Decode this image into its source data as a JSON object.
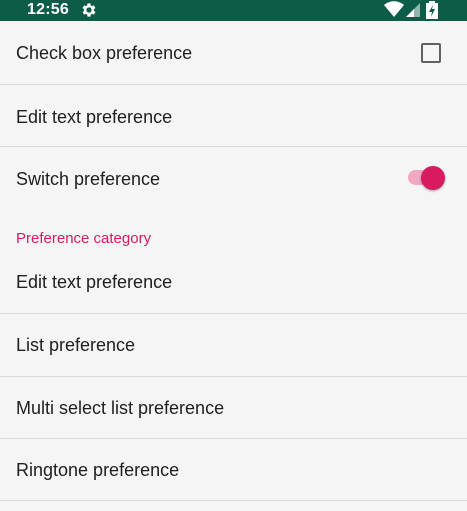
{
  "status_bar": {
    "time": "12:56",
    "icons": [
      "gear-icon",
      "wifi-icon",
      "signal-icon",
      "battery-icon"
    ]
  },
  "preferences": {
    "check_box": {
      "title": "Check box preference",
      "checked": false
    },
    "edit_text": {
      "title": "Edit text preference"
    },
    "switch": {
      "title": "Switch preference",
      "on": true
    }
  },
  "category": {
    "title": "Preference category",
    "items": [
      {
        "title": "Edit text preference"
      },
      {
        "title": "List preference"
      },
      {
        "title": "Multi select list preference"
      },
      {
        "title": "Ringtone preference"
      }
    ]
  },
  "colors": {
    "status_bar": "#0c5c47",
    "accent": "#d81b60",
    "switch_track": "#f1a8c2",
    "background": "#f5f5f5"
  }
}
